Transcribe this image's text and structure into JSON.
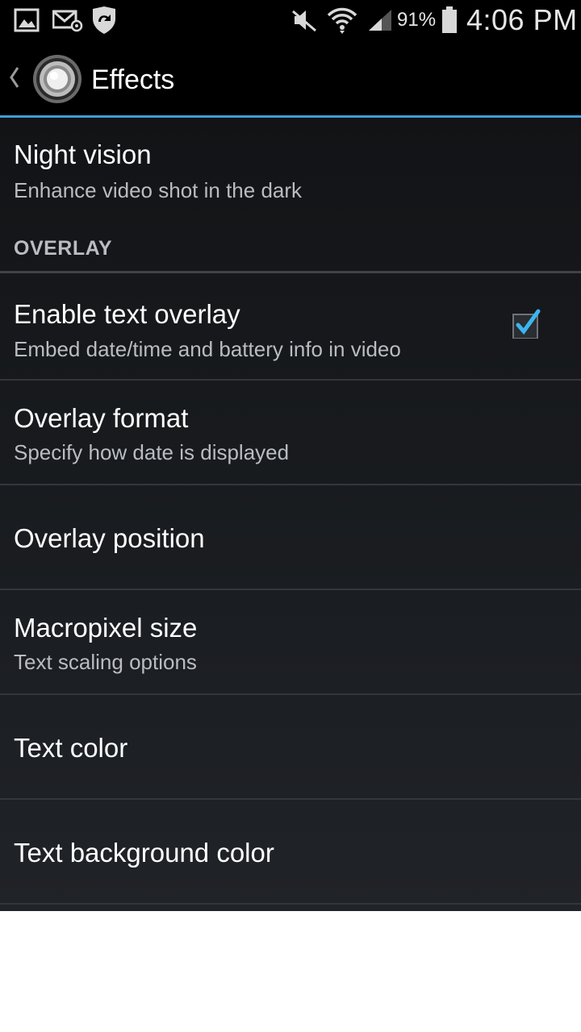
{
  "status_bar": {
    "battery_percent": "91%",
    "time": "4:06 PM",
    "icons": [
      "gallery-icon",
      "email-icon",
      "shield-sync-icon",
      "mute-icon",
      "wifi-icon",
      "signal-icon",
      "battery-icon"
    ]
  },
  "action_bar": {
    "title": "Effects",
    "accent_color": "#3c9ed6"
  },
  "preferences": {
    "night_vision": {
      "title": "Night vision",
      "summary": "Enhance video shot in the dark"
    },
    "category": "OVERLAY",
    "enable_text_overlay": {
      "title": "Enable text overlay",
      "summary": "Embed date/time and battery info in video",
      "checked": true
    },
    "overlay_format": {
      "title": "Overlay format",
      "summary": "Specify how date is displayed"
    },
    "overlay_position": {
      "title": "Overlay position"
    },
    "macropixel_size": {
      "title": "Macropixel size",
      "summary": "Text scaling options"
    },
    "text_color": {
      "title": "Text color"
    },
    "text_background_color": {
      "title": "Text background color"
    }
  }
}
